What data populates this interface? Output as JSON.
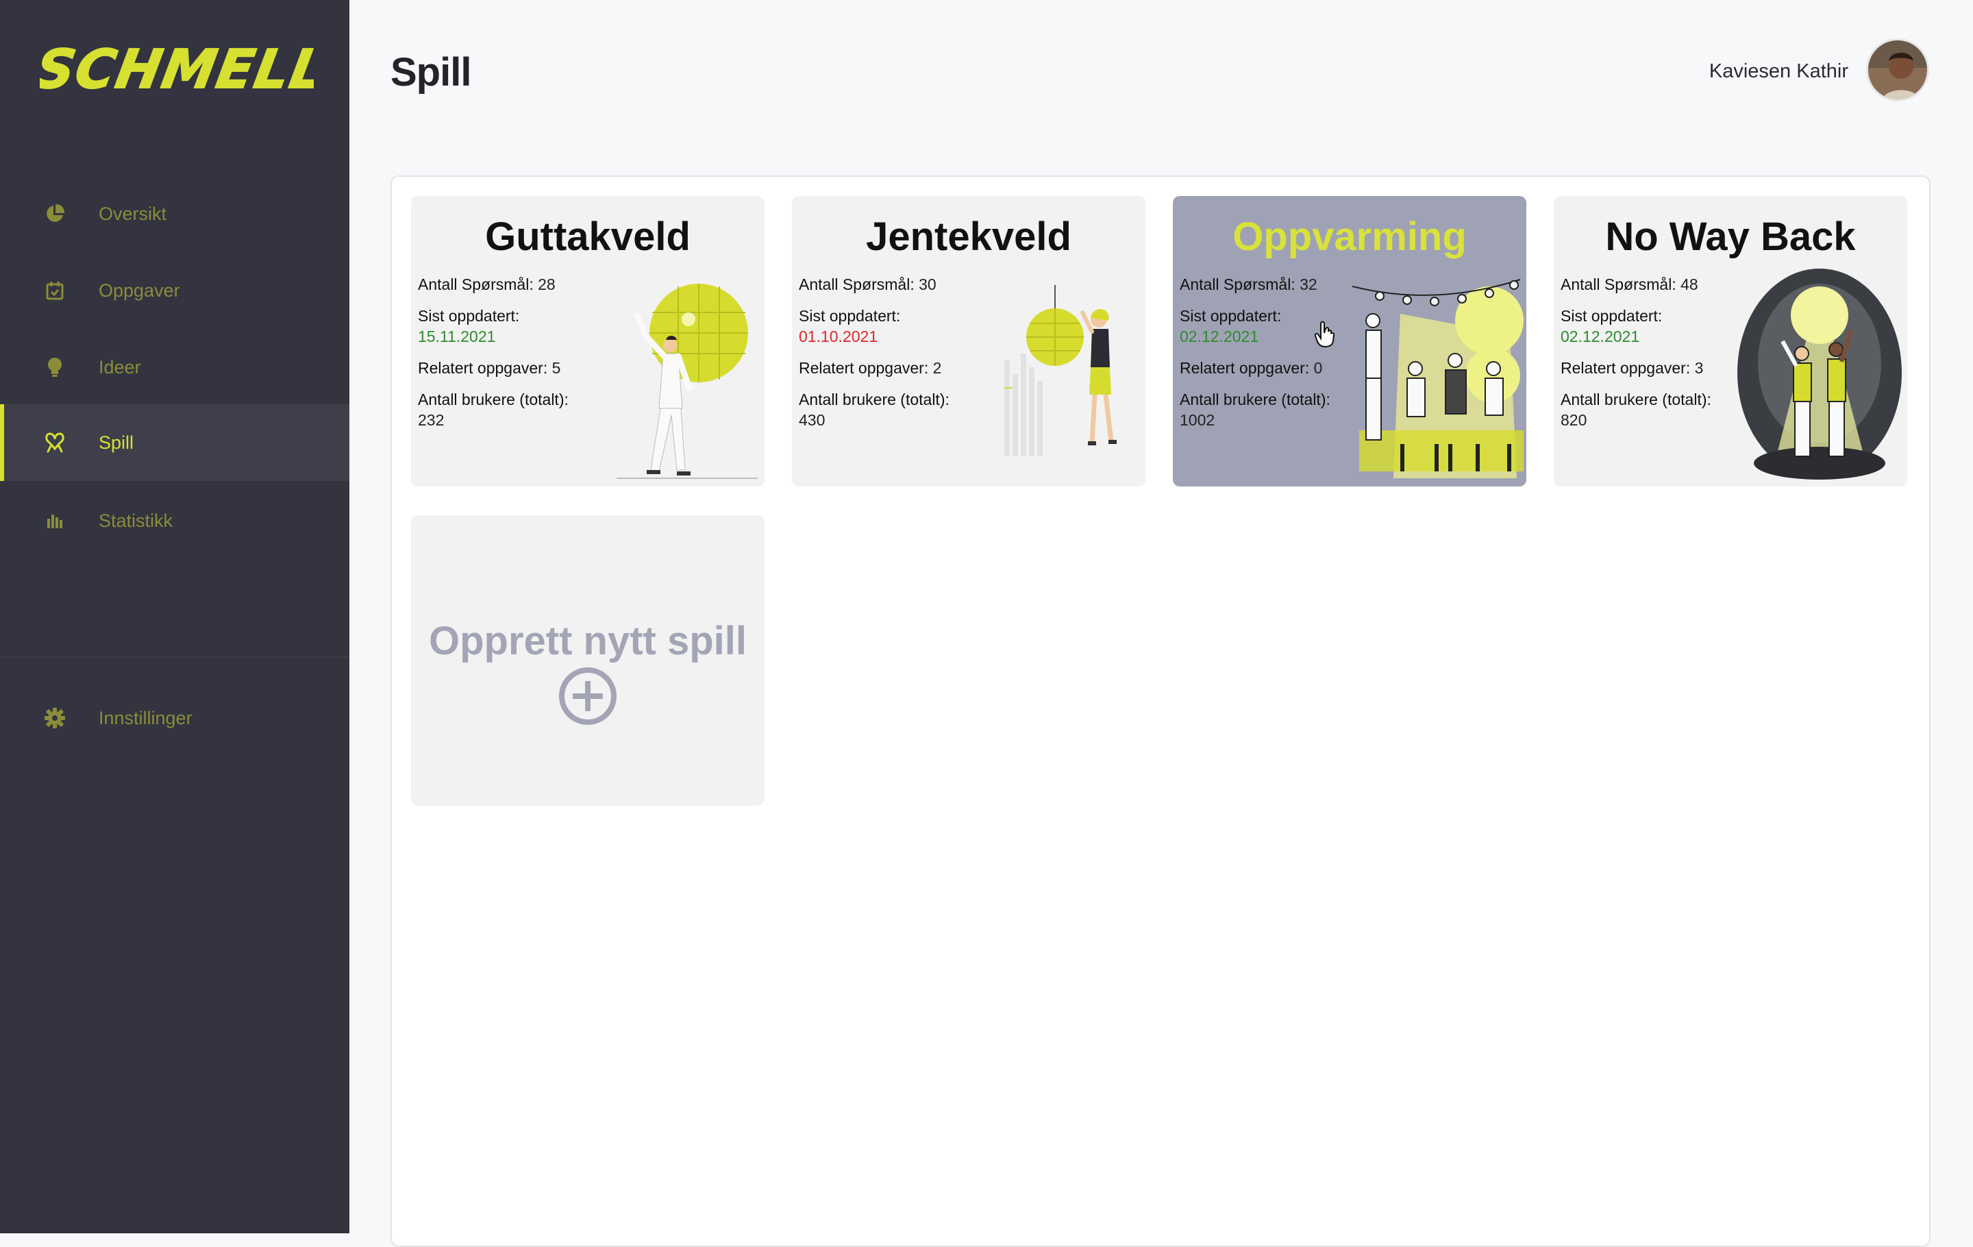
{
  "app": {
    "logo_text": "SCHMELL!"
  },
  "sidebar": {
    "items": [
      {
        "label": "Oversikt",
        "icon": "pie-chart-icon"
      },
      {
        "label": "Oppgaver",
        "icon": "calendar-check-icon"
      },
      {
        "label": "Ideer",
        "icon": "lightbulb-icon"
      },
      {
        "label": "Spill",
        "icon": "ribbon-icon",
        "active": true
      },
      {
        "label": "Statistikk",
        "icon": "bar-chart-icon"
      }
    ],
    "settings": {
      "label": "Innstillinger",
      "icon": "gear-icon"
    }
  },
  "header": {
    "title": "Spill",
    "user_name": "Kaviesen Kathir"
  },
  "labels": {
    "questions": "Antall Spørsmål:",
    "updated": "Sist oppdatert:",
    "related": "Relatert oppgaver:",
    "users": "Antall brukere (totalt):"
  },
  "games": [
    {
      "title": "Guttakveld",
      "questions": "28",
      "updated": "15.11.2021",
      "updated_status": "green",
      "related": "5",
      "users": "232"
    },
    {
      "title": "Jentekveld",
      "questions": "30",
      "updated": "01.10.2021",
      "updated_status": "red",
      "related": "2",
      "users": "430"
    },
    {
      "title": "Oppvarming",
      "questions": "32",
      "updated": "02.12.2021",
      "updated_status": "green",
      "related": "0",
      "users": "1002",
      "hovered": true
    },
    {
      "title": "No Way Back",
      "questions": "48",
      "updated": "02.12.2021",
      "updated_status": "green",
      "related": "3",
      "users": "820"
    }
  ],
  "create": {
    "label": "Opprett nytt spill"
  },
  "colors": {
    "accent": "#d6e030",
    "sidebar": "#33343f",
    "hover_card": "#9fa2b4",
    "date_green": "#2e8b2e",
    "date_red": "#e0262b"
  }
}
